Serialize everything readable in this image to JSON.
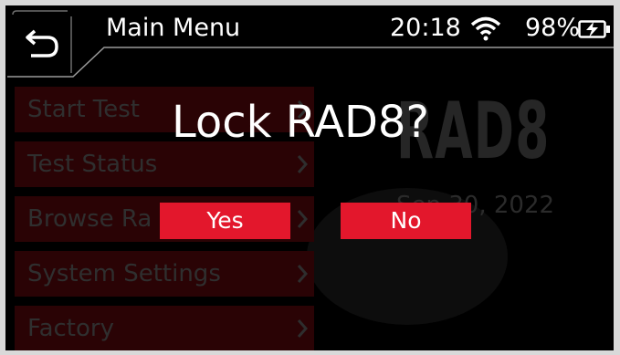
{
  "header": {
    "title": "Main Menu",
    "time": "20:18",
    "battery_percent": "98%",
    "icons": [
      "back-icon",
      "wifi-icon",
      "battery-charging-icon"
    ]
  },
  "menu": {
    "items": [
      {
        "label": "Start Test"
      },
      {
        "label": "Test Status"
      },
      {
        "label": "Browse Ra"
      },
      {
        "label": "System Settings"
      },
      {
        "label": "Factory"
      }
    ]
  },
  "background": {
    "logo": "RAD8",
    "date": "Sep 30, 2022"
  },
  "dialog": {
    "message": "Lock RAD8?",
    "yes_label": "Yes",
    "no_label": "No"
  },
  "colors": {
    "accent": "#e3172c",
    "menu_item_dim": "#2a0305",
    "header_background": "#000000",
    "frame": "#d9d9d9"
  }
}
